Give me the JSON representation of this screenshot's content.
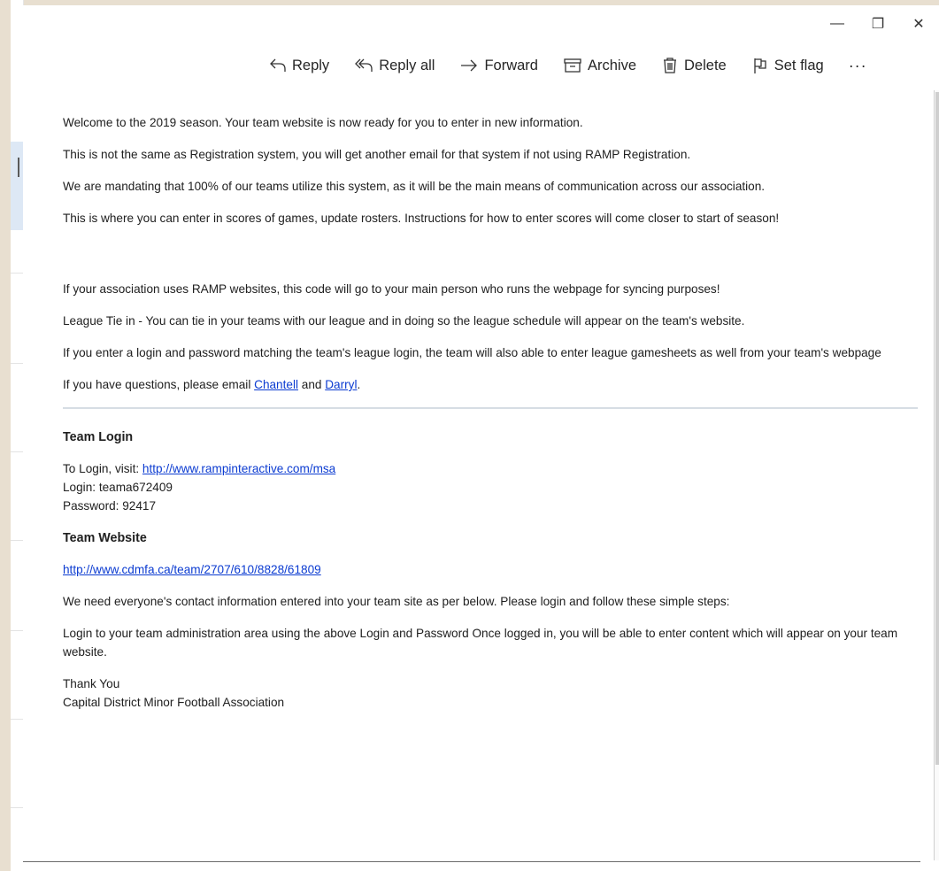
{
  "window_controls": {
    "minimize": "—",
    "restore": "❐",
    "close": "✕"
  },
  "toolbar": {
    "reply": "Reply",
    "reply_all": "Reply all",
    "forward": "Forward",
    "archive": "Archive",
    "delete": "Delete",
    "set_flag": "Set flag",
    "more": "···"
  },
  "email": {
    "paragraphs_top": [
      "Welcome to the 2019 season. Your team website is now ready for you to enter in new information.",
      "This is not the same as Registration system, you will get another email for that system if not using RAMP Registration.",
      "We are mandating that 100% of our teams utilize this system, as it will be the main means of communication across our association.",
      "This is where you can enter in scores of games, update rosters. Instructions for how to enter scores will come closer to start of season!"
    ],
    "paragraphs_mid": [
      "If your association uses RAMP websites, this code will go to your main person who runs the webpage for syncing purposes!",
      "League Tie in - You can tie in your teams with our league and in doing so the league schedule will appear on the team's website.",
      "If you enter a login and password matching the team's league login, the team will also able to enter league gamesheets as well from your team's webpage"
    ],
    "questions": {
      "prefix": "If you have questions, please email ",
      "link1": "Chantell",
      "middle": " and ",
      "link2": "Darryl",
      "suffix": "."
    },
    "team_login": {
      "heading": "Team Login",
      "visit_prefix": "To Login, visit: ",
      "visit_link": "http://www.rampinteractive.com/msa",
      "login": "Login: teama672409",
      "password": "Password: 92417"
    },
    "team_website": {
      "heading": "Team Website",
      "link": "http://www.cdmfa.ca/team/2707/610/8828/61809",
      "paragraphs": [
        "We need everyone's contact information entered into your team site as per below. Please login and follow these simple steps:",
        "Login to your team administration area using the above Login and Password Once logged in, you will be able to enter content which will appear on your team website."
      ]
    },
    "signoff": {
      "thanks": "Thank You",
      "org": "Capital District Minor Football Association"
    }
  }
}
